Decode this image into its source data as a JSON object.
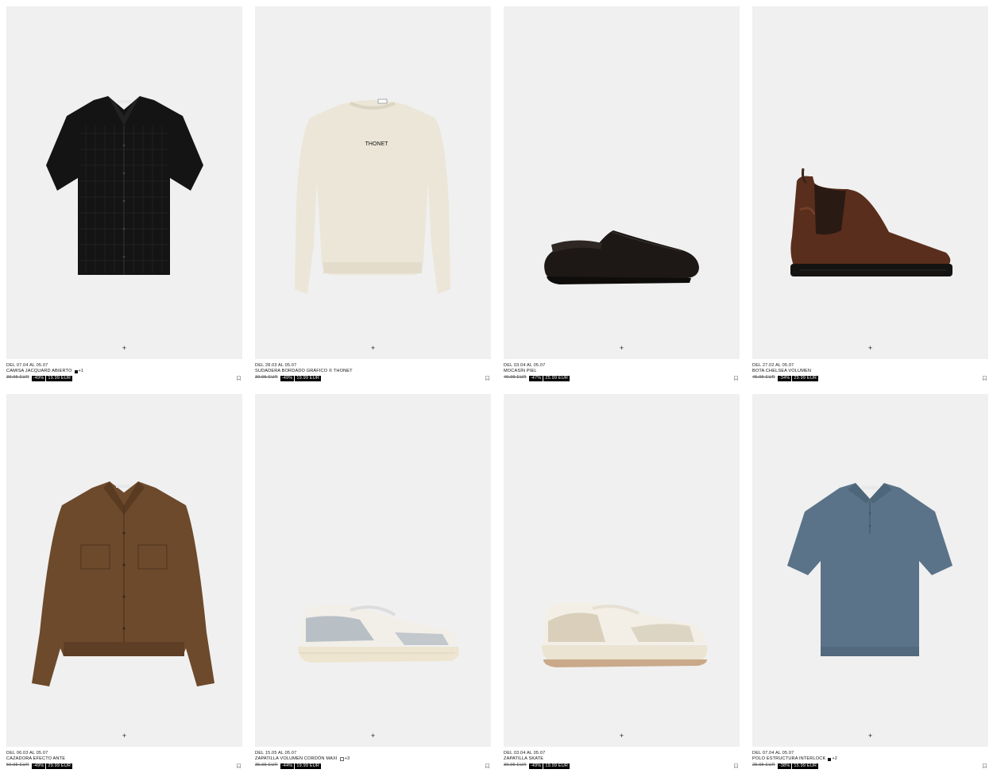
{
  "products": [
    {
      "dates": "DEL 07.04 AL 05.07",
      "name": "CAMISA JACQUARD ABIERTO",
      "swatch": "black",
      "more": "+1",
      "old_price": "39.95 EUR",
      "discount": "-49%",
      "new_price": "19.99 EUR",
      "image_alt": "black-shirt"
    },
    {
      "dates": "DEL 28.03 AL 05.07",
      "name": "SUDADERA BORDADO GRÁFICO © THONET",
      "swatch": "",
      "more": "",
      "old_price": "39.95 EUR",
      "discount": "-49%",
      "new_price": "19.99 EUR",
      "image_alt": "cream-sweatshirt",
      "print": "THONET"
    },
    {
      "dates": "DEL 03.04 AL 05.07",
      "name": "MOCASÍN PIEL",
      "swatch": "",
      "more": "",
      "old_price": "49.95 EUR",
      "discount": "-47%",
      "new_price": "25.99 EUR",
      "image_alt": "black-loafer"
    },
    {
      "dates": "DEL 27.02 AL 05.07",
      "name": "BOTA CHELSEA VOLUMEN",
      "swatch": "",
      "more": "",
      "old_price": "45.95 EUR",
      "discount": "-34%",
      "new_price": "29.99 EUR",
      "image_alt": "brown-chelsea-boot"
    },
    {
      "dates": "DEL 06.03 AL 05.07",
      "name": "CAZADORA EFECTO ANTE",
      "swatch": "",
      "more": "",
      "old_price": "59.95 EUR",
      "discount": "-49%",
      "new_price": "29.99 EUR",
      "image_alt": "brown-suede-jacket"
    },
    {
      "dates": "DEL 15.05 AL 05.07",
      "name": "ZAPATILLA VOLUMEN CORDÓN MAXI",
      "swatch": "outline",
      "more": "+3",
      "old_price": "35.95 EUR",
      "discount": "-44%",
      "new_price": "19.99 EUR",
      "image_alt": "grey-sneaker"
    },
    {
      "dates": "DEL 03.04 AL 05.07",
      "name": "ZAPATILLA SKATE",
      "swatch": "",
      "more": "",
      "old_price": "39.95 EUR",
      "discount": "-49%",
      "new_price": "19.99 EUR",
      "image_alt": "beige-skate-sneaker"
    },
    {
      "dates": "DEL 07.04 AL 05.07",
      "name": "POLO ESTRUCTURA INTERLOCK",
      "swatch": "black",
      "more": "+2",
      "old_price": "25.95 EUR",
      "discount": "-38%",
      "new_price": "15.99 EUR",
      "image_alt": "blue-polo"
    }
  ],
  "ui": {
    "plus_label": "+"
  },
  "colors": {
    "card_bg": "#f0f0f0",
    "price_badge_bg": "#000000",
    "price_badge_text": "#ffffff"
  }
}
